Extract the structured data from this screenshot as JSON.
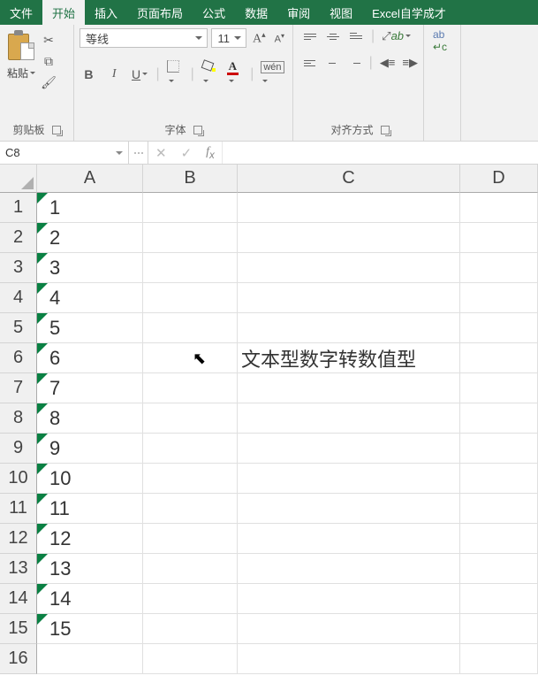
{
  "tabs": {
    "file": "文件",
    "home": "开始",
    "insert": "插入",
    "layout": "页面布局",
    "formula": "公式",
    "data": "数据",
    "review": "审阅",
    "view": "视图",
    "custom": "Excel自学成才"
  },
  "ribbon": {
    "clipboard": {
      "paste": "粘贴",
      "label": "剪贴板"
    },
    "font": {
      "name": "等线",
      "size": "11",
      "label": "字体",
      "wen": "wén"
    },
    "align": {
      "label": "对齐方式"
    }
  },
  "namebox": "C8",
  "columns": {
    "a": "A",
    "b": "B",
    "c": "C",
    "d": "D"
  },
  "rows": [
    "1",
    "2",
    "3",
    "4",
    "5",
    "6",
    "7",
    "8",
    "9",
    "10",
    "11",
    "12",
    "13",
    "14",
    "15",
    "16"
  ],
  "colA": [
    "1",
    "2",
    "3",
    "4",
    "5",
    "6",
    "7",
    "8",
    "9",
    "10",
    "11",
    "12",
    "13",
    "14",
    "15",
    ""
  ],
  "c6": "文本型数字转数值型",
  "chart_data": {
    "type": "table",
    "title": "文本型数字转数值型",
    "columns": [
      "A",
      "B",
      "C",
      "D"
    ],
    "rows": [
      [
        "1",
        "",
        "",
        ""
      ],
      [
        "2",
        "",
        "",
        ""
      ],
      [
        "3",
        "",
        "",
        ""
      ],
      [
        "4",
        "",
        "",
        ""
      ],
      [
        "5",
        "",
        "",
        ""
      ],
      [
        "6",
        "",
        "文本型数字转数值型",
        ""
      ],
      [
        "7",
        "",
        "",
        ""
      ],
      [
        "8",
        "",
        "",
        ""
      ],
      [
        "9",
        "",
        "",
        ""
      ],
      [
        "10",
        "",
        "",
        ""
      ],
      [
        "11",
        "",
        "",
        ""
      ],
      [
        "12",
        "",
        "",
        ""
      ],
      [
        "13",
        "",
        "",
        ""
      ],
      [
        "14",
        "",
        "",
        ""
      ],
      [
        "15",
        "",
        "",
        ""
      ],
      [
        "",
        "",
        "",
        ""
      ]
    ],
    "note": "Column A values 1–15 are stored as text (green triangle indicator)"
  }
}
